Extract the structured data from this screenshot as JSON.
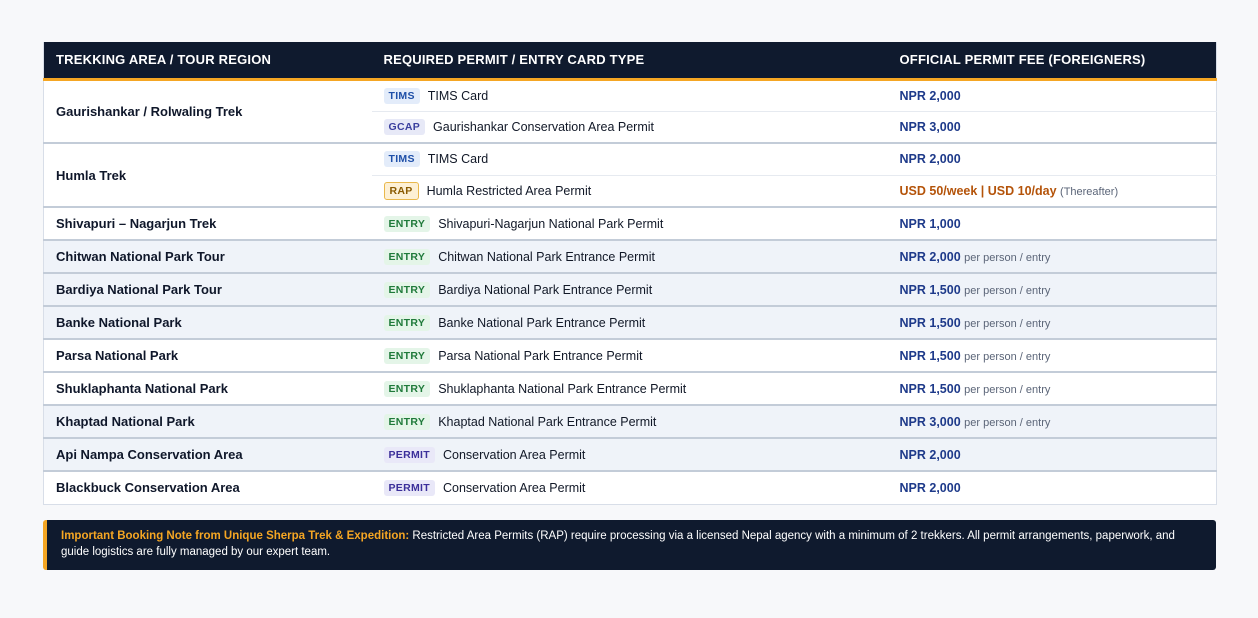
{
  "table": {
    "headers": [
      "TREKKING AREA / TOUR REGION",
      "REQUIRED PERMIT / ENTRY CARD TYPE",
      "OFFICIAL PERMIT FEE (FOREIGNERS)"
    ],
    "groups": [
      {
        "region": "Gaurishankar / Rolwaling Trek",
        "permits": [
          {
            "badge": "TIMS",
            "name": "TIMS Card",
            "fee": "NPR 2,000",
            "note": ""
          },
          {
            "badge": "GCAP",
            "name": "Gaurishankar Conservation Area Permit",
            "fee": "NPR 3,000",
            "note": ""
          }
        ]
      },
      {
        "region": "Humla Trek",
        "permits": [
          {
            "badge": "TIMS",
            "name": "TIMS Card",
            "fee": "NPR 2,000",
            "note": ""
          },
          {
            "badge": "RAP",
            "name": "Humla Restricted Area Permit",
            "fee": "USD 50/week | USD 10/day",
            "note": "(Thereafter)"
          }
        ]
      }
    ],
    "rows": [
      {
        "region": "Shivapuri – Nagarjun Trek",
        "badge": "ENTRY",
        "name": "Shivapuri-Nagarjun National Park Permit",
        "fee": "NPR 1,000",
        "note": ""
      },
      {
        "region": "Chitwan National Park Tour",
        "badge": "ENTRY",
        "name": "Chitwan National Park Entrance Permit",
        "fee": "NPR 2,000",
        "note": "per person / entry"
      },
      {
        "region": "Bardiya National Park Tour",
        "badge": "ENTRY",
        "name": "Bardiya National Park Entrance Permit",
        "fee": "NPR 1,500",
        "note": "per person / entry"
      },
      {
        "region": "Banke National Park",
        "badge": "ENTRY",
        "name": "Banke National Park Entrance Permit",
        "fee": "NPR 1,500",
        "note": "per person / entry"
      },
      {
        "region": "Parsa National Park",
        "badge": "ENTRY",
        "name": "Parsa National Park Entrance Permit",
        "fee": "NPR 1,500",
        "note": "per person / entry"
      },
      {
        "region": "Shuklaphanta National Park",
        "badge": "ENTRY",
        "name": "Shuklaphanta National Park Entrance Permit",
        "fee": "NPR 1,500",
        "note": "per person / entry"
      },
      {
        "region": "Khaptad National Park",
        "badge": "ENTRY",
        "name": "Khaptad National Park Entrance Permit",
        "fee": "NPR 3,000",
        "note": "per person / entry"
      },
      {
        "region": "Api Nampa Conservation Area",
        "badge": "PERMIT",
        "name": "Conservation Area Permit",
        "fee": "NPR 2,000",
        "note": ""
      },
      {
        "region": "Blackbuck Conservation Area",
        "badge": "PERMIT",
        "name": "Conservation Area Permit",
        "fee": "NPR 2,000",
        "note": ""
      }
    ]
  },
  "note": {
    "lead": "Important Booking Note from Unique Sherpa Trek & Expedition:",
    "text": " Restricted Area Permits (RAP) require processing via a licensed Nepal agency with a minimum of 2 trekkers. All permit arrangements, paperwork, and guide logistics are fully managed by our expert team."
  },
  "colors": {
    "header_bg": "#0f1a2e",
    "accent": "#f5a623",
    "fee_npr": "#1e3a8a",
    "fee_usd": "#b45309"
  }
}
